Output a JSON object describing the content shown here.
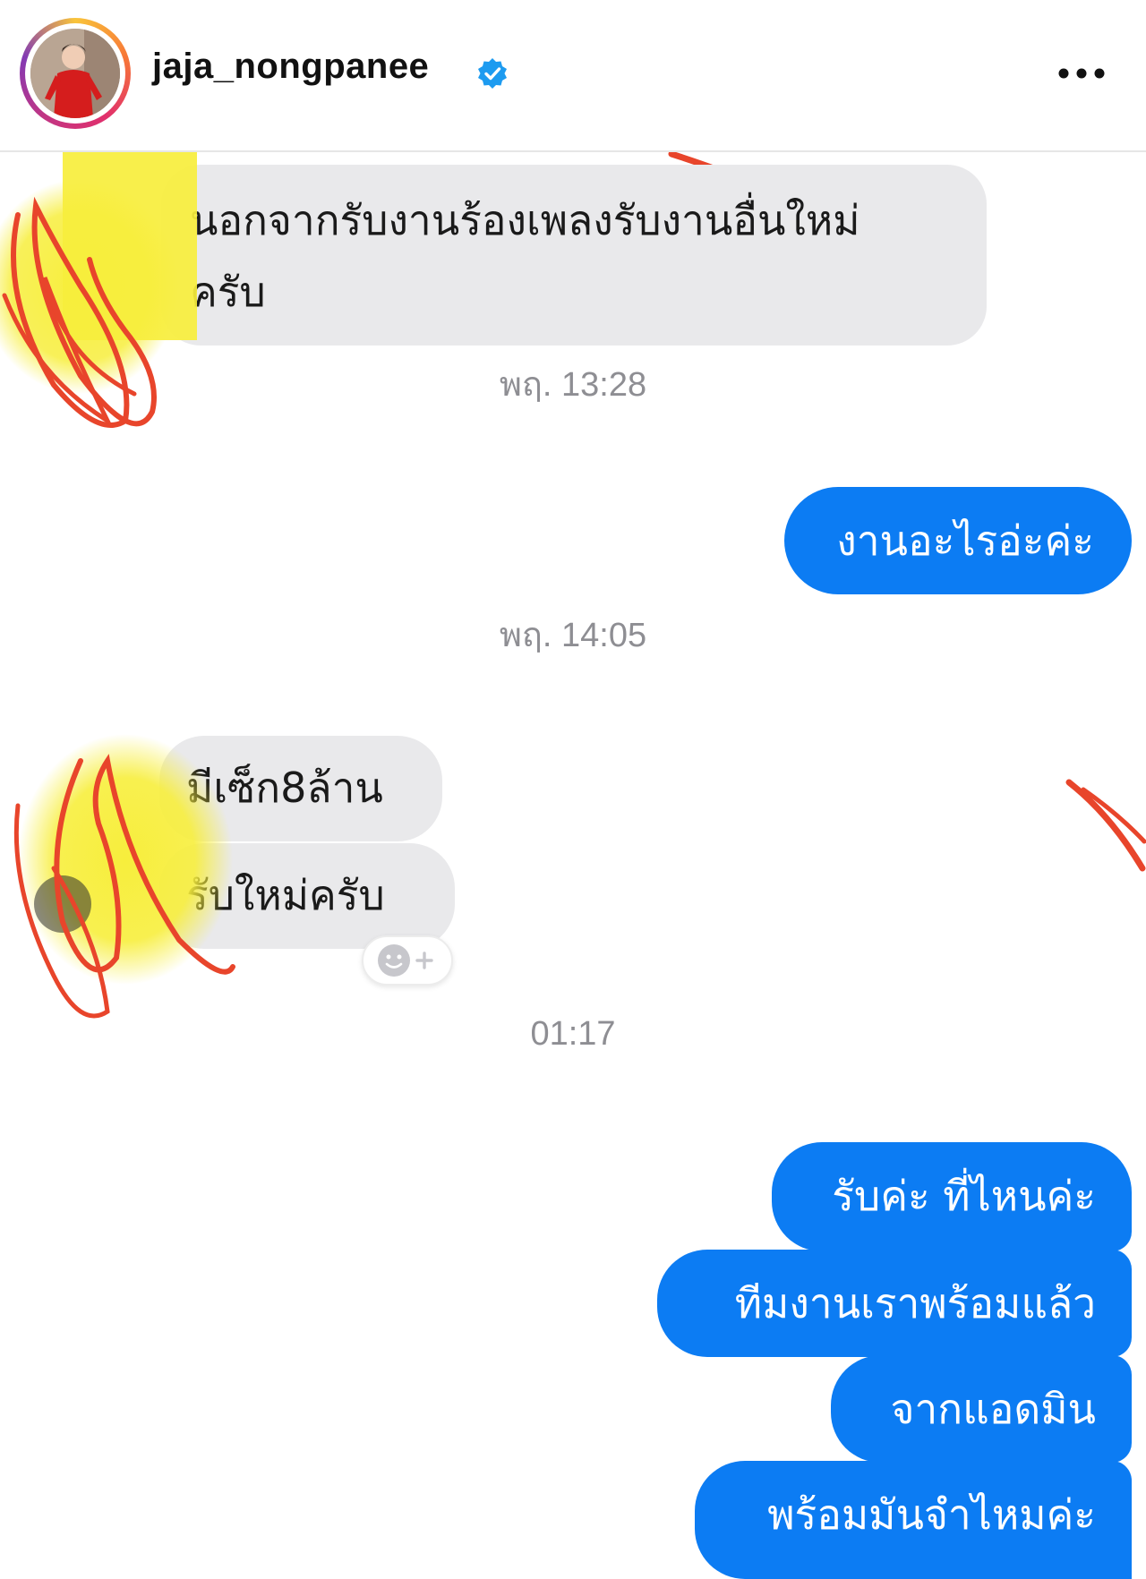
{
  "header": {
    "username": "jaja_nongpanee",
    "verified_icon": "verified-badge-icon",
    "more_icon": "more-options-icon"
  },
  "messages": {
    "incoming_1_line1": "นอกจากรับงานร้องเพลงรับงานอื่นใหม่",
    "incoming_1_line2": "ครับ",
    "timestamp_1": "พฤ. 13:28",
    "outgoing_1": "งานอะไรอ่ะค่ะ",
    "timestamp_2": "พฤ. 14:05",
    "incoming_2": "มีเซ็ก8ล้าน",
    "incoming_3": "รับใหม่ครับ",
    "timestamp_3": "01:17",
    "outgoing_2": "รับค่ะ ที่ไหนค่ะ",
    "outgoing_3": "ทีมงานเราพร้อมแล้ว",
    "outgoing_4": "จากแอดมิน",
    "outgoing_5": "พร้อมมันจำไหมค่ะ"
  },
  "colors": {
    "outgoing_bubble": "#0c7cf3",
    "incoming_bubble": "#e9e9eb",
    "timestamp_text": "#8e8e93",
    "redaction_red": "#e8452b",
    "redaction_yellow": "#f7ee3c"
  },
  "icons": {
    "reaction": "add-reaction-icon"
  }
}
